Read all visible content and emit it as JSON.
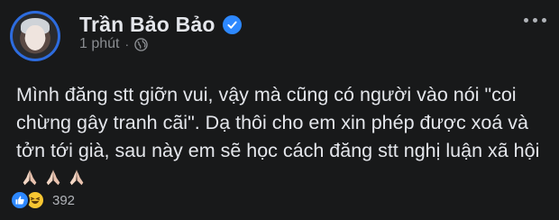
{
  "post": {
    "author": "Trần Bảo Bảo",
    "time": "1 phút",
    "separator": "·",
    "text": "Mình đăng stt giỡn vui, vậy mà cũng có người vào nói \"coi chừng gây tranh cãi\". Dạ thôi cho em xin phép được xoá và tởn tới già, sau này em sẽ học cách đăng stt nghị luận xã hội",
    "emoji_icons": [
      "pray-icon",
      "pray-icon",
      "pray-icon"
    ],
    "reaction_icons": [
      "like-icon",
      "haha-icon"
    ],
    "reaction_count": "392"
  },
  "colors": {
    "background": "#18191a",
    "text": "#e4e6eb",
    "muted": "#8a8d91",
    "verified": "#2d88ff",
    "like": "#2d88ff",
    "haha": "#f7c632"
  }
}
